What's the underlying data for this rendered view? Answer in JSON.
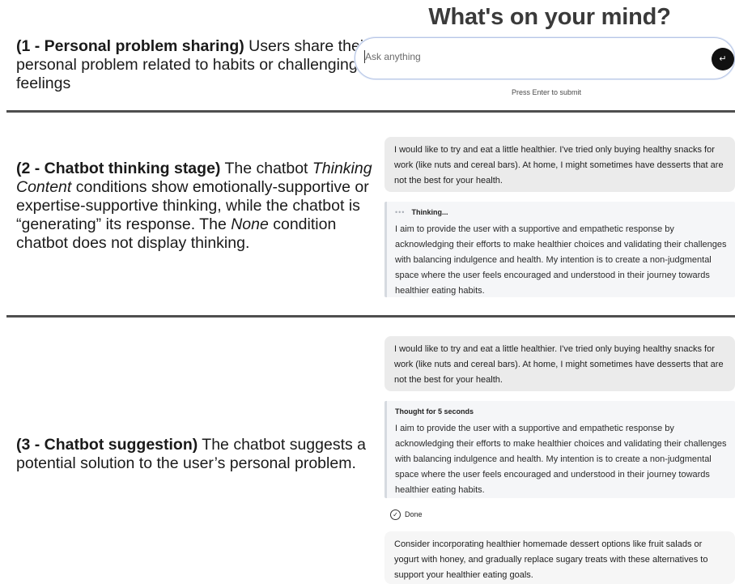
{
  "section1": {
    "caption_bold": "(1 - Personal problem sharing)",
    "caption_rest": " Users share their personal problem related to habits or challenging feelings",
    "title": "What's on your mind?",
    "input_placeholder": "Ask anything",
    "send_icon": "return-arrow-icon",
    "hint": "Press Enter to submit"
  },
  "section2": {
    "caption_bold": "(2 - Chatbot thinking stage)",
    "caption_a": " The chatbot ",
    "caption_italic_1": "Thinking Content",
    "caption_b": " conditions show emotionally-supportive or expertise-supportive thinking, while the chatbot is “generating” its response. The ",
    "caption_italic_2": "None",
    "caption_c": " condition chatbot does not display thinking.",
    "user_message": "I would like to try and eat a little healthier. I've tried only buying healthy snacks for work (like nuts and cereal bars). At home, I might sometimes have desserts that are not the best for your health.",
    "thinking_dots": "•••",
    "thinking_label": "Thinking...",
    "thinking_text": "I aim to provide the user with a supportive and empathetic response by acknowledging their efforts to make healthier choices and validating their challenges with balancing indulgence and health. My intention is to create a non-judgmental space where the user feels encouraged and understood in their journey towards healthier eating habits."
  },
  "section3": {
    "caption_bold": "(3 - Chatbot suggestion)",
    "caption_rest": " The chatbot suggests a potential solution to the user’s personal problem.",
    "user_message": "I would like to try and eat a little healthier. I've tried only buying healthy snacks for work (like nuts and cereal bars). At home, I might sometimes have desserts that are not the best for your health.",
    "thought_label": "Thought for 5 seconds",
    "thinking_text": "I aim to provide the user with a supportive and empathetic response by acknowledging their efforts to make healthier choices and validating their challenges with balancing indulgence and health. My intention is to create a non-judgmental space where the user feels encouraged and understood in their journey towards healthier eating habits.",
    "done_icon": "check-circle-icon",
    "done_label": "Done",
    "answer": "Consider incorporating healthier homemade dessert options like fruit salads or yogurt with honey, and gradually replace sugary treats with these alternatives to support your healthier eating goals."
  }
}
